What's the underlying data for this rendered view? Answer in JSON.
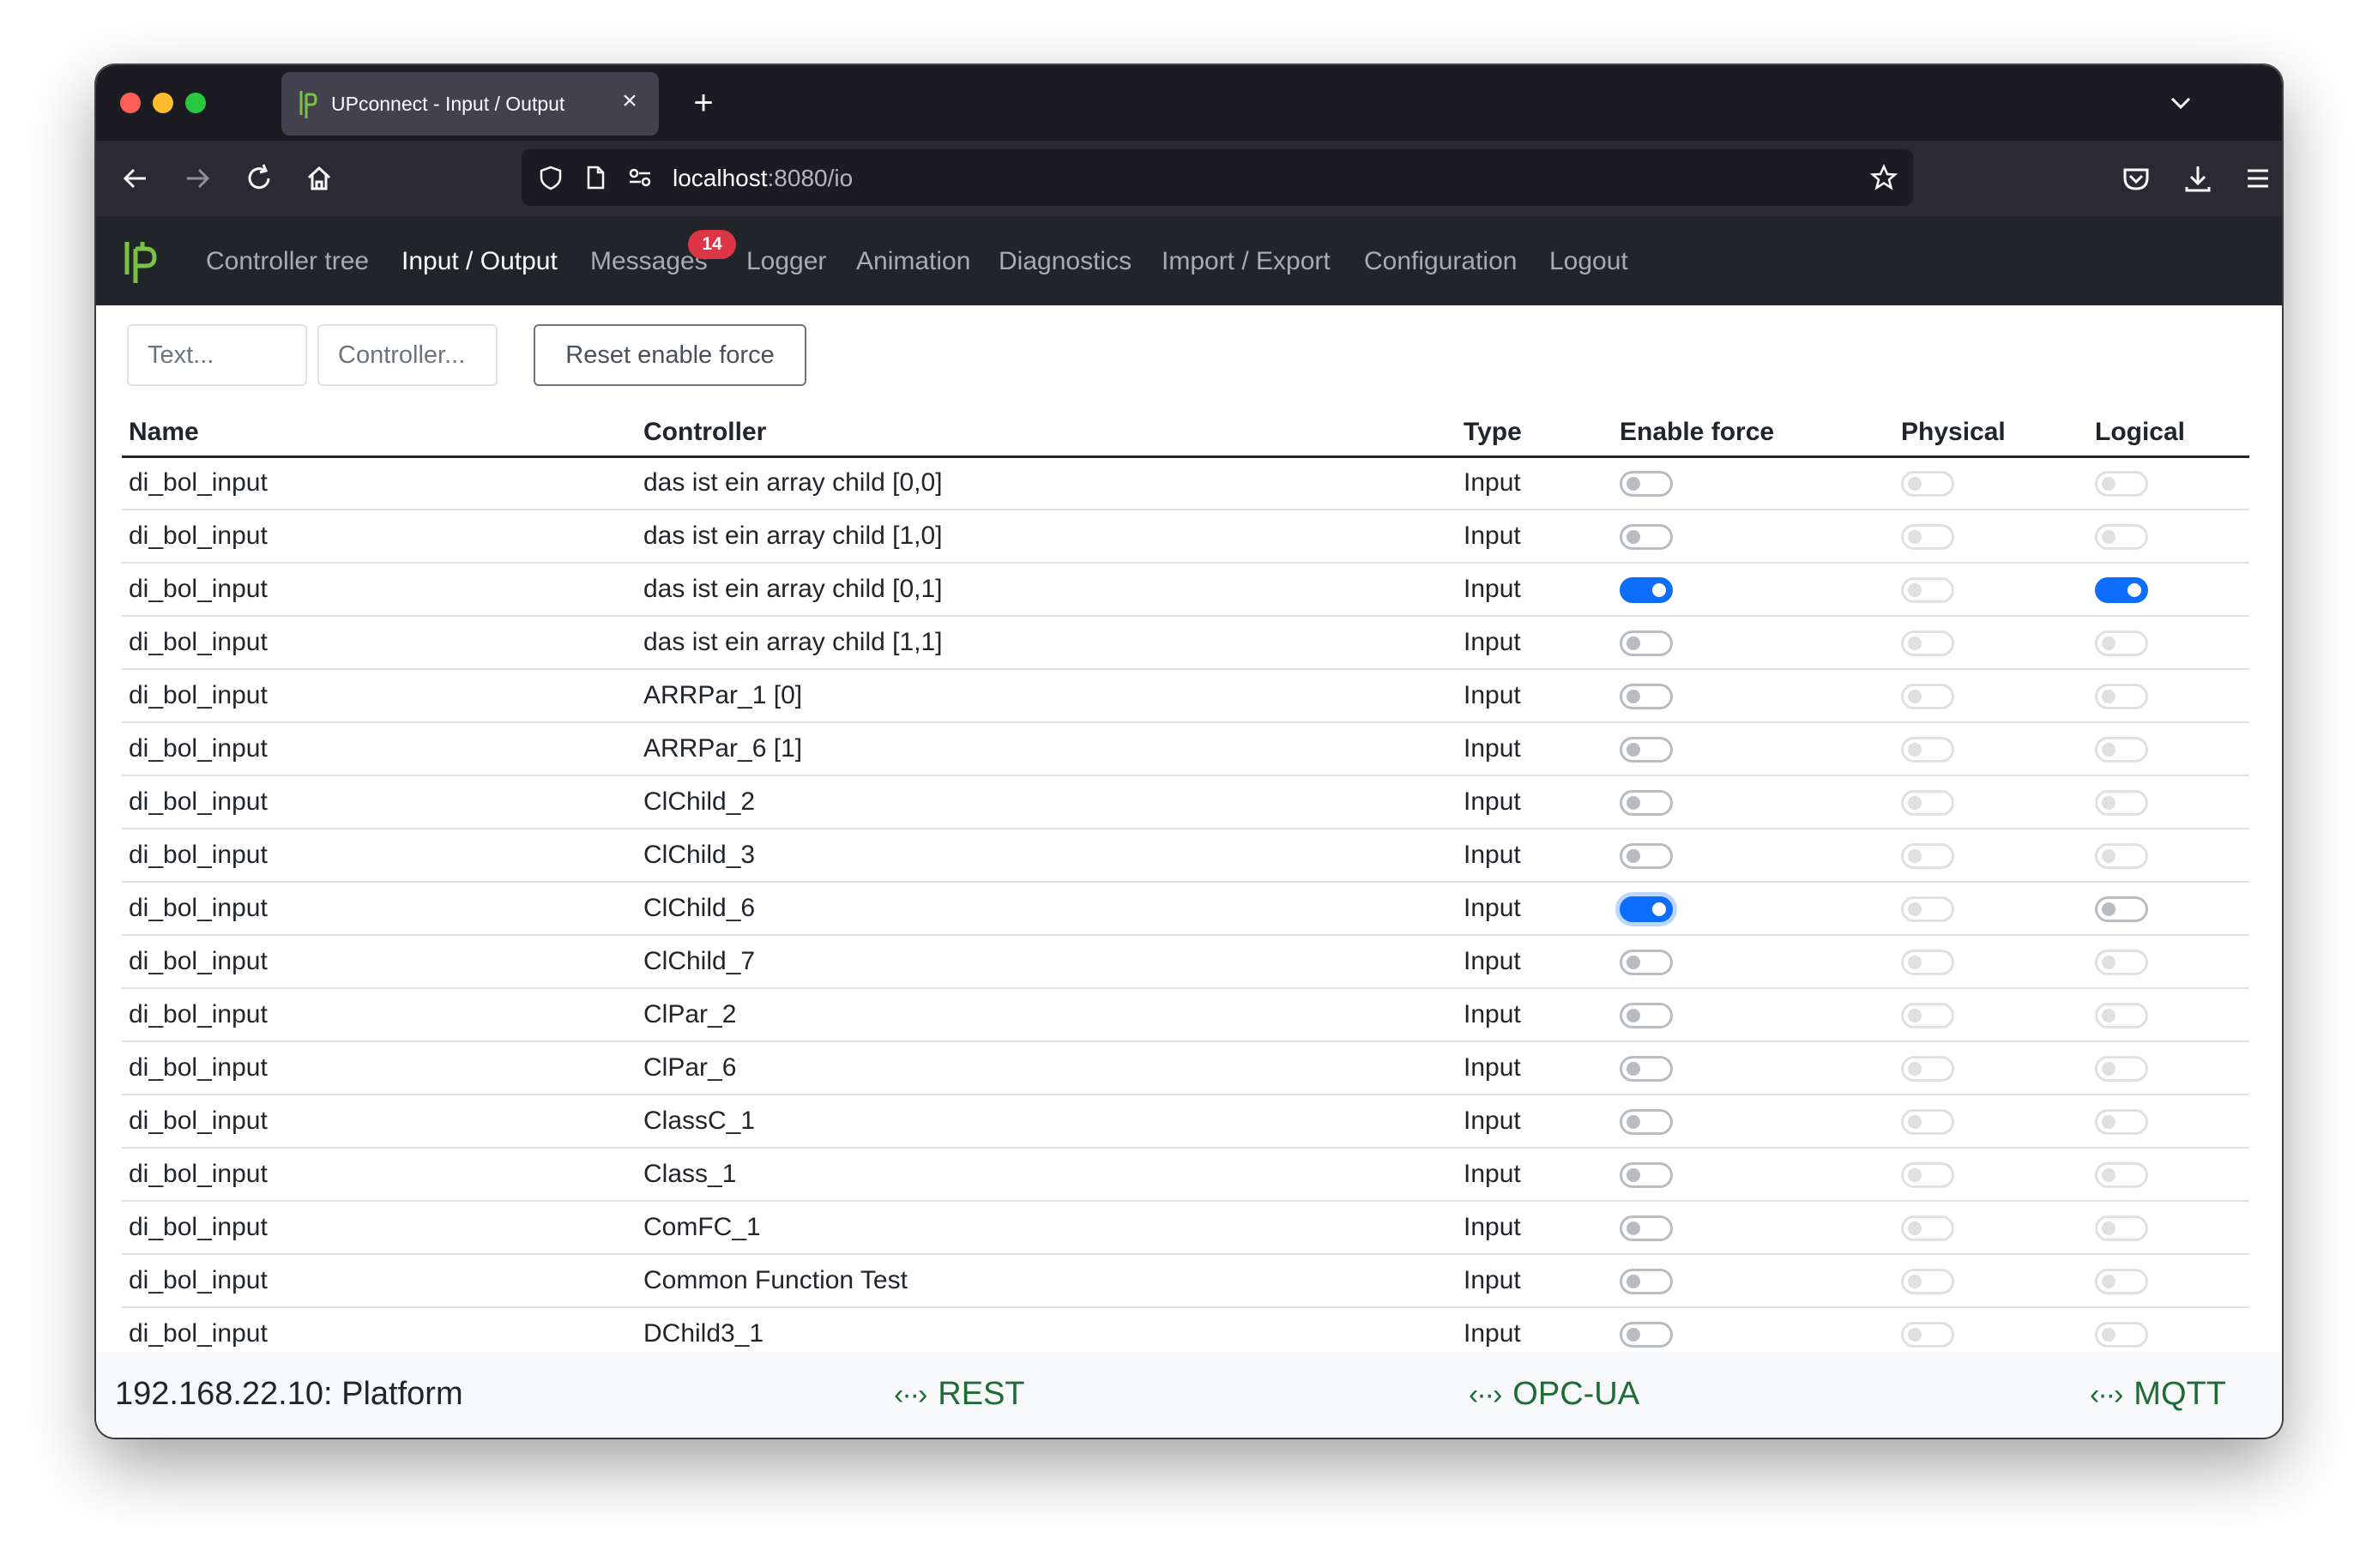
{
  "browser": {
    "tab_title": "UPconnect - Input / Output",
    "tab_close": "×",
    "new_tab": "+",
    "url_host": "localhost",
    "url_rest": ":8080/io"
  },
  "app": {
    "menu": [
      {
        "label": "Controller tree",
        "active": false
      },
      {
        "label": "Input / Output",
        "active": true
      },
      {
        "label": "Messages",
        "active": false
      },
      {
        "label": "Logger",
        "active": false
      },
      {
        "label": "Animation",
        "active": false
      },
      {
        "label": "Diagnostics",
        "active": false
      },
      {
        "label": "Import / Export",
        "active": false
      },
      {
        "label": "Configuration",
        "active": false
      },
      {
        "label": "Logout",
        "active": false
      }
    ],
    "messages_badge": "14"
  },
  "filters": {
    "text_placeholder": "Text...",
    "controller_placeholder": "Controller...",
    "reset_label": "Reset enable force"
  },
  "table": {
    "headers": [
      "Name",
      "Controller",
      "Type",
      "Enable force",
      "Physical",
      "Logical"
    ],
    "rows": [
      {
        "name": "di_bol_input",
        "controller": "das ist ein array child [0,0]",
        "type": "Input",
        "enable_force": false,
        "physical": false,
        "logical": false
      },
      {
        "name": "di_bol_input",
        "controller": "das ist ein array child [1,0]",
        "type": "Input",
        "enable_force": false,
        "physical": false,
        "logical": false
      },
      {
        "name": "di_bol_input",
        "controller": "das ist ein array child [0,1]",
        "type": "Input",
        "enable_force": true,
        "physical": false,
        "logical": true
      },
      {
        "name": "di_bol_input",
        "controller": "das ist ein array child [1,1]",
        "type": "Input",
        "enable_force": false,
        "physical": false,
        "logical": false
      },
      {
        "name": "di_bol_input",
        "controller": "ARRPar_1 [0]",
        "type": "Input",
        "enable_force": false,
        "physical": false,
        "logical": false
      },
      {
        "name": "di_bol_input",
        "controller": "ARRPar_6 [1]",
        "type": "Input",
        "enable_force": false,
        "physical": false,
        "logical": false
      },
      {
        "name": "di_bol_input",
        "controller": "ClChild_2",
        "type": "Input",
        "enable_force": false,
        "physical": false,
        "logical": false
      },
      {
        "name": "di_bol_input",
        "controller": "ClChild_3",
        "type": "Input",
        "enable_force": false,
        "physical": false,
        "logical": false
      },
      {
        "name": "di_bol_input",
        "controller": "ClChild_6",
        "type": "Input",
        "enable_force": true,
        "physical": false,
        "logical": false,
        "logical_editable": true,
        "focused": true
      },
      {
        "name": "di_bol_input",
        "controller": "ClChild_7",
        "type": "Input",
        "enable_force": false,
        "physical": false,
        "logical": false
      },
      {
        "name": "di_bol_input",
        "controller": "ClPar_2",
        "type": "Input",
        "enable_force": false,
        "physical": false,
        "logical": false
      },
      {
        "name": "di_bol_input",
        "controller": "ClPar_6",
        "type": "Input",
        "enable_force": false,
        "physical": false,
        "logical": false
      },
      {
        "name": "di_bol_input",
        "controller": "ClassC_1",
        "type": "Input",
        "enable_force": false,
        "physical": false,
        "logical": false
      },
      {
        "name": "di_bol_input",
        "controller": "Class_1",
        "type": "Input",
        "enable_force": false,
        "physical": false,
        "logical": false
      },
      {
        "name": "di_bol_input",
        "controller": "ComFC_1",
        "type": "Input",
        "enable_force": false,
        "physical": false,
        "logical": false
      },
      {
        "name": "di_bol_input",
        "controller": "Common Function Test",
        "type": "Input",
        "enable_force": false,
        "physical": false,
        "logical": false
      },
      {
        "name": "di_bol_input",
        "controller": "DChild3_1",
        "type": "Input",
        "enable_force": false,
        "physical": false,
        "logical": false
      }
    ]
  },
  "footer": {
    "host": "192.168.22.10: Platform",
    "links": [
      "REST",
      "OPC-UA",
      "MQTT"
    ],
    "link_icon": "‹··›"
  },
  "colors": {
    "accent": "#0d6efd",
    "logo_green": "#7cc242",
    "footer_link": "#1e6b36",
    "badge": "#dc3545"
  }
}
